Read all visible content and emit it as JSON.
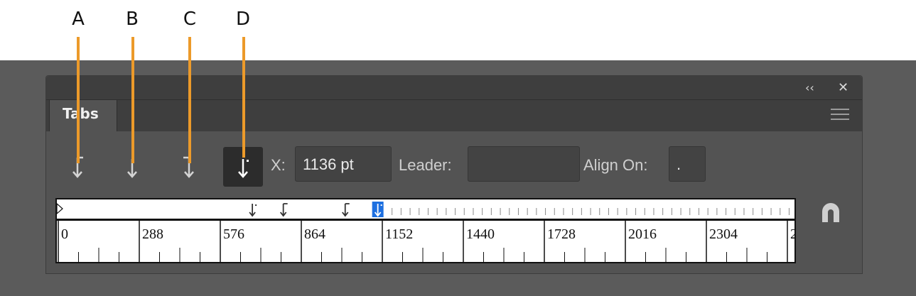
{
  "callouts": [
    "A",
    "B",
    "C",
    "D"
  ],
  "header": {
    "collapse_glyph": "‹‹",
    "close_glyph": "✕"
  },
  "panel": {
    "tab_title": "Tabs"
  },
  "tab_types": [
    {
      "name": "left-justified-tab-icon",
      "selected": false
    },
    {
      "name": "center-justified-tab-icon",
      "selected": false
    },
    {
      "name": "right-justified-tab-icon",
      "selected": false
    },
    {
      "name": "decimal-justified-tab-icon",
      "selected": true
    }
  ],
  "fields": {
    "x_label": "X:",
    "x_value": "1136 pt",
    "leader_label": "Leader:",
    "leader_value": "",
    "align_on_label": "Align On:",
    "align_on_value": "."
  },
  "ruler": {
    "unit": "pt",
    "labels": [
      "0",
      "288",
      "576",
      "864",
      "1152",
      "1440",
      "1728",
      "2016",
      "2304",
      "2"
    ],
    "tab_stops": [
      {
        "type": "decimal",
        "position": 690
      },
      {
        "type": "left",
        "position": 800
      },
      {
        "type": "left",
        "position": 1020
      },
      {
        "type": "decimal",
        "position": 1136,
        "selected": true
      }
    ]
  },
  "colors": {
    "callout": "#ec9a2a",
    "selected_tab_stop": "#1d6fe0",
    "panel_bg": "#535353",
    "outer_bg": "#5b5b5b"
  },
  "icons": {
    "snap": "magnet-icon",
    "menu": "hamburger-menu-icon"
  }
}
